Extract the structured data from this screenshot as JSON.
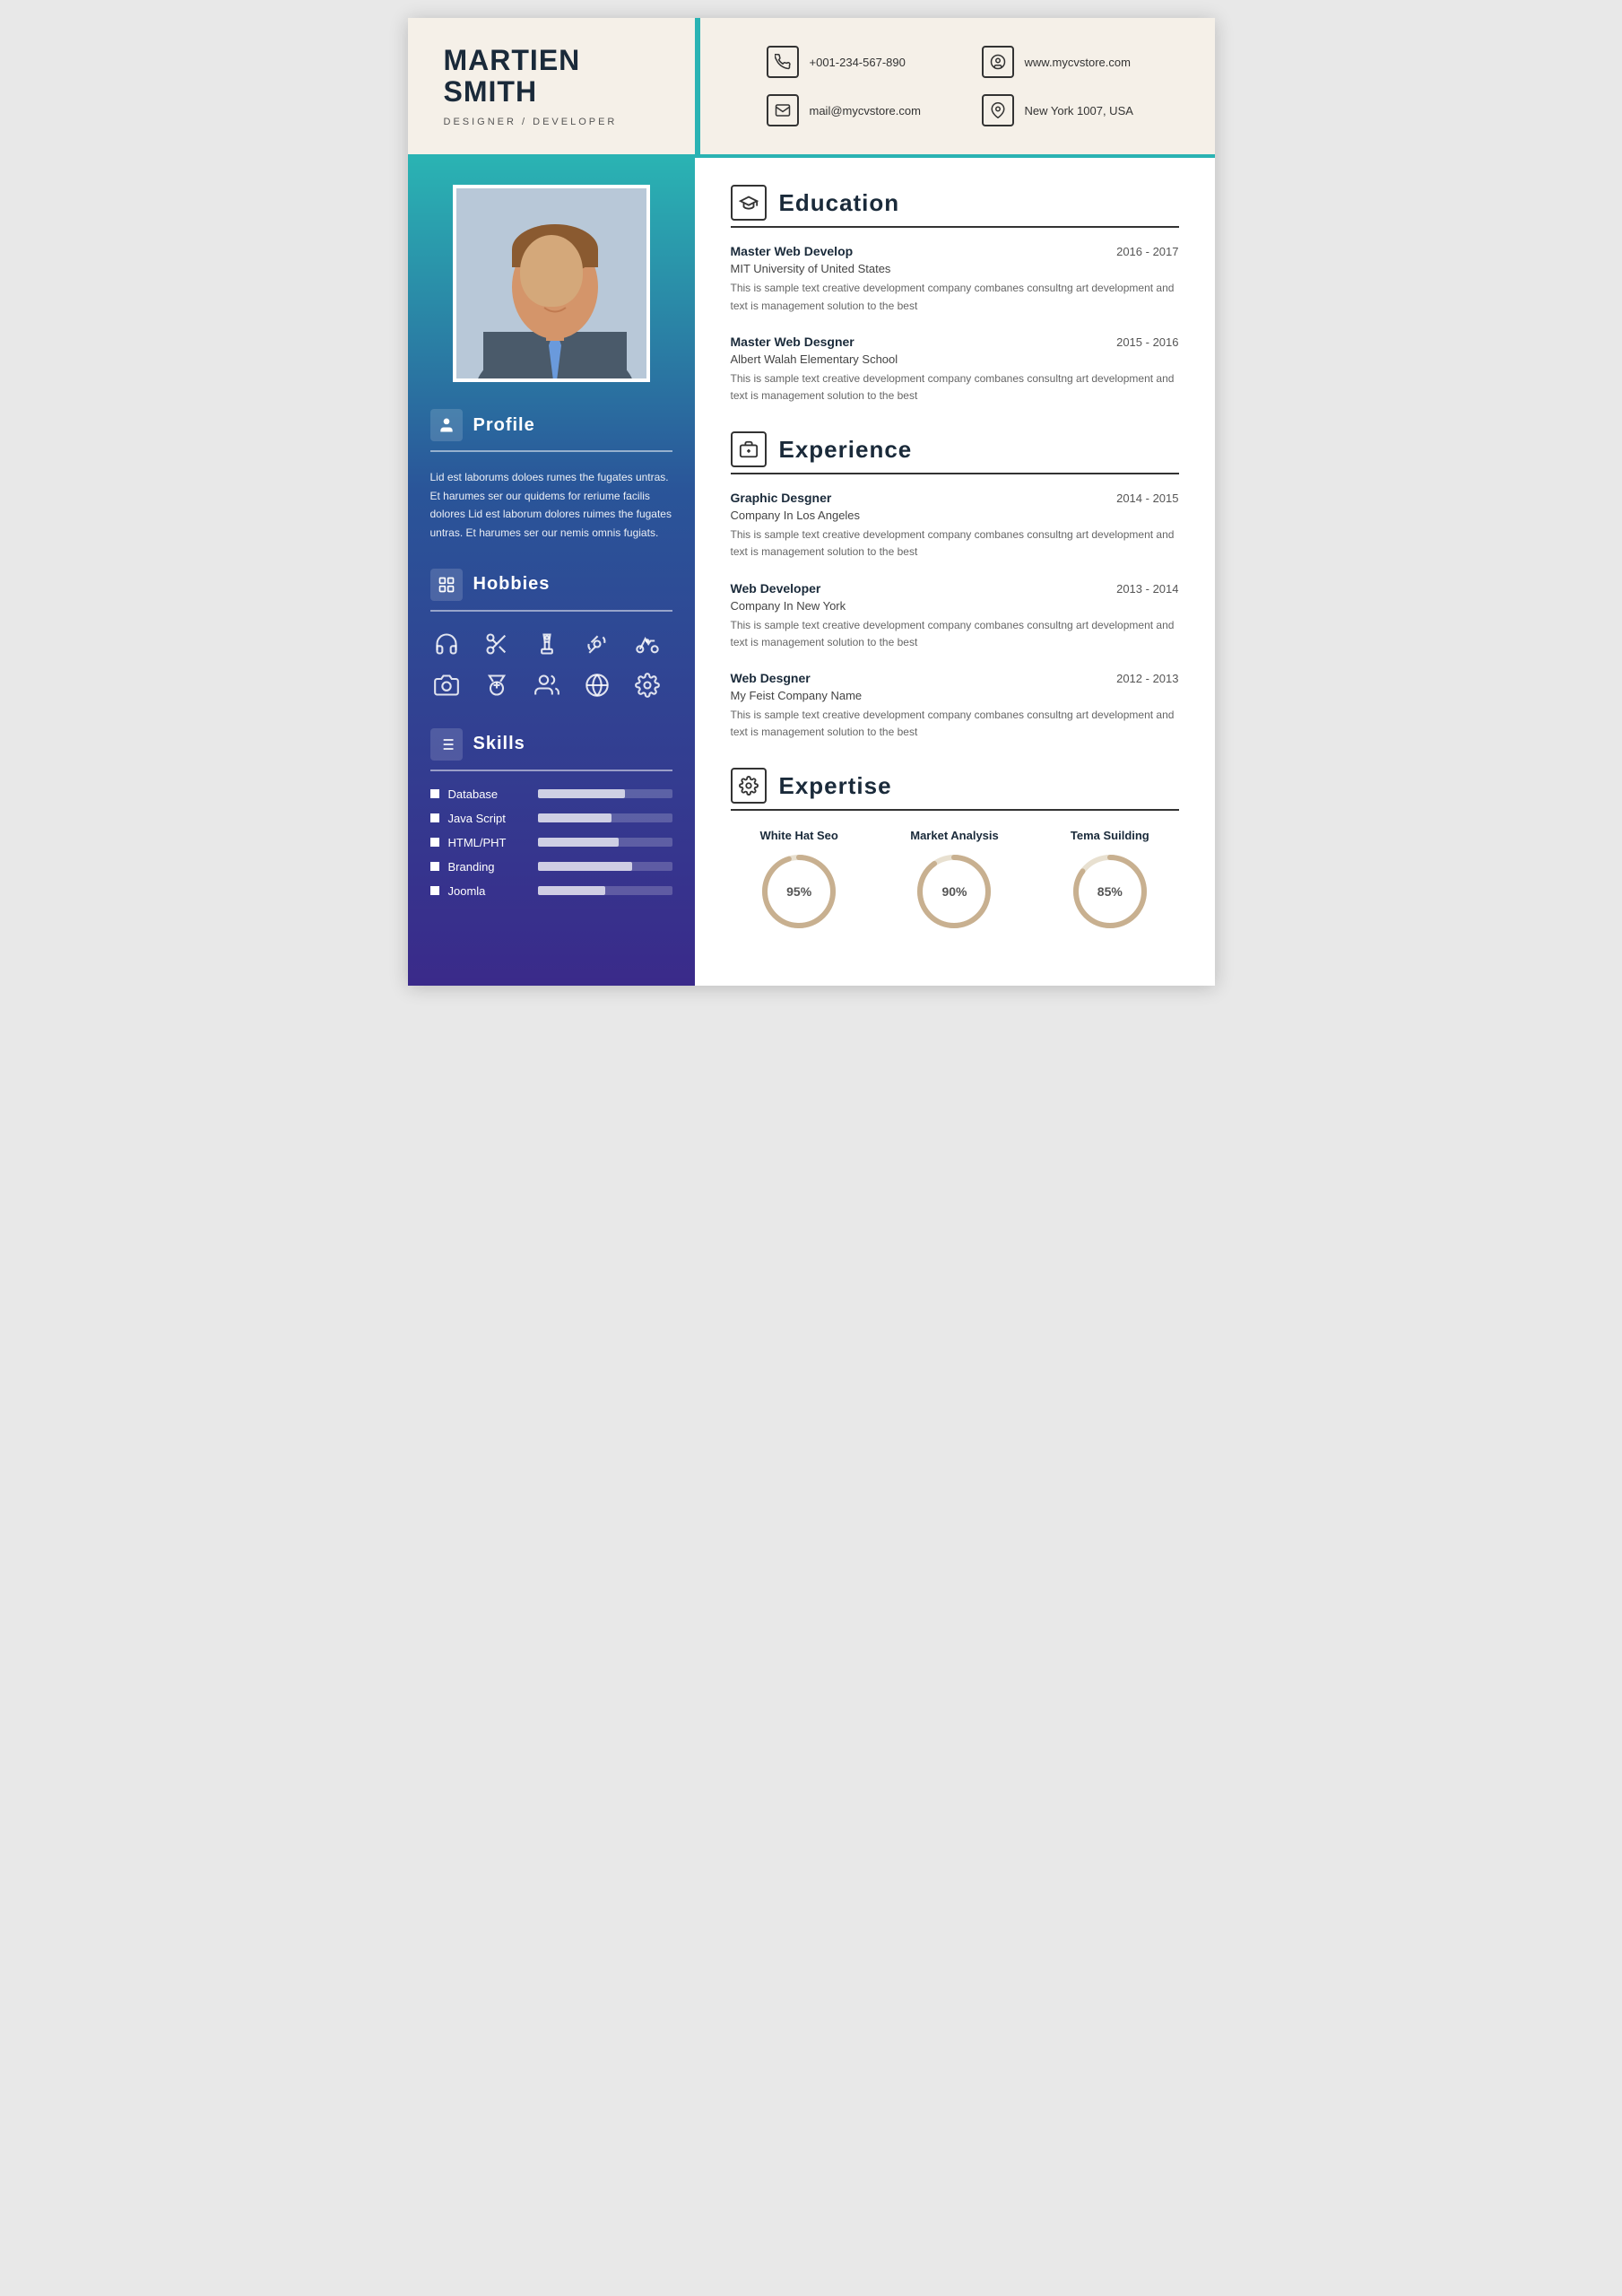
{
  "header": {
    "name_line1": "MARTIEN",
    "name_line2": "SMITH",
    "title": "DESIGNER / DEVELOPER",
    "contacts": [
      {
        "icon": "📞",
        "text": "+001-234-567-890",
        "id": "phone"
      },
      {
        "icon": "🖱",
        "text": "www.mycvstore.com",
        "id": "website"
      },
      {
        "icon": "✉",
        "text": "mail@mycvstore.com",
        "id": "email"
      },
      {
        "icon": "📍",
        "text": "New York 1007, USA",
        "id": "location"
      }
    ]
  },
  "sidebar": {
    "profile_section": {
      "title": "Profile",
      "text": "Lid est laborums doloes rumes the fugates untras. Et harumes ser our quidems for reriume facilis dolores Lid est laborum dolores ruimes the fugates untras. Et harumes ser our nemis omnis fugiats."
    },
    "hobbies_section": {
      "title": "Hobbies",
      "icons": [
        "🎧",
        "✂",
        "♟",
        "📡",
        "🚴",
        "📷",
        "🏅",
        "👥",
        "🎯",
        "⚙"
      ]
    },
    "skills_section": {
      "title": "Skills",
      "items": [
        {
          "name": "Database",
          "percent": 65
        },
        {
          "name": "Java Script",
          "percent": 55
        },
        {
          "name": "HTML/PHT",
          "percent": 60
        },
        {
          "name": "Branding",
          "percent": 70
        },
        {
          "name": "Joomla",
          "percent": 50
        }
      ]
    }
  },
  "main": {
    "education": {
      "title": "Education",
      "entries": [
        {
          "title": "Master Web Develop",
          "date": "2016 - 2017",
          "subtitle": "MIT University of United States",
          "desc": "This is sample text creative development company combanes consultng art development and text is management solution to the best"
        },
        {
          "title": "Master Web Desgner",
          "date": "2015 - 2016",
          "subtitle": "Albert Walah Elementary School",
          "desc": "This is sample text creative development company combanes consultng art development and text is management solution to the best"
        }
      ]
    },
    "experience": {
      "title": "Experience",
      "entries": [
        {
          "title": "Graphic Desgner",
          "date": "2014 - 2015",
          "subtitle": "Company In Los Angeles",
          "desc": "This is sample text creative development company combanes consultng art development and text is management solution to the best"
        },
        {
          "title": "Web Developer",
          "date": "2013 - 2014",
          "subtitle": "Company In New York",
          "desc": "This is sample text creative development company combanes consultng art development and text is management solution to the best"
        },
        {
          "title": "Web Desgner",
          "date": "2012 - 2013",
          "subtitle": "My Feist Company Name",
          "desc": "This is sample text creative development company combanes consultng art development and text is management solution to the best"
        }
      ]
    },
    "expertise": {
      "title": "Expertise",
      "items": [
        {
          "label": "White Hat Seo",
          "percent": 95
        },
        {
          "label": "Market Analysis",
          "percent": 90
        },
        {
          "label": "Tema Suilding",
          "percent": 85
        }
      ]
    }
  }
}
